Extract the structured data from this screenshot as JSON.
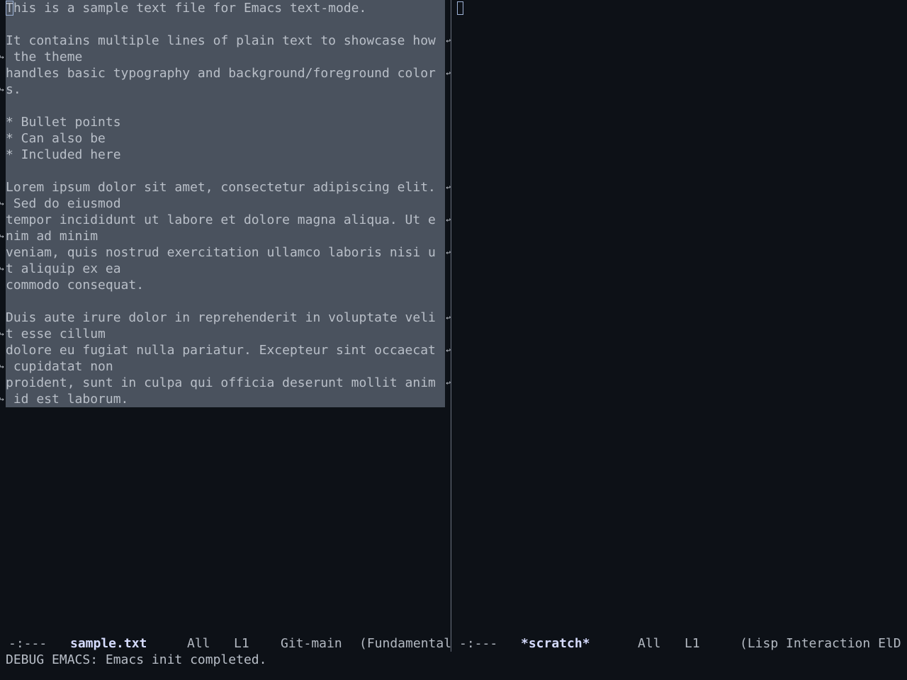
{
  "left_window": {
    "first_char": "T",
    "lines": [
      {
        "text": "his is a sample text file for Emacs text-mode."
      },
      {
        "text": ""
      },
      {
        "text": "It contains multiple lines of plain text to showcase how"
      },
      {
        "text": " the theme"
      },
      {
        "text": "handles basic typography and background/foreground color"
      },
      {
        "text": "s."
      },
      {
        "text": ""
      },
      {
        "text": "* Bullet points"
      },
      {
        "text": "* Can also be"
      },
      {
        "text": "* Included here"
      },
      {
        "text": ""
      },
      {
        "text": "Lorem ipsum dolor sit amet, consectetur adipiscing elit."
      },
      {
        "text": " Sed do eiusmod"
      },
      {
        "text": "tempor incididunt ut labore et dolore magna aliqua. Ut e"
      },
      {
        "text": "nim ad minim"
      },
      {
        "text": "veniam, quis nostrud exercitation ullamco laboris nisi u"
      },
      {
        "text": "t aliquip ex ea"
      },
      {
        "text": "commodo consequat."
      },
      {
        "text": ""
      },
      {
        "text": "Duis aute irure dolor in reprehenderit in voluptate veli"
      },
      {
        "text": "t esse cillum"
      },
      {
        "text": "dolore eu fugiat nulla pariatur. Excepteur sint occaecat"
      },
      {
        "text": " cupidatat non"
      },
      {
        "text": "proident, sunt in culpa qui officia deserunt mollit anim"
      },
      {
        "text": " id est laborum."
      }
    ]
  },
  "modeline_left": {
    "status": "-:---",
    "buffer": "sample.txt",
    "position": "All",
    "line": "L1",
    "vc": "Git-main",
    "mode": "(Fundamental"
  },
  "modeline_right": {
    "status": "-:---",
    "buffer": "*scratch*",
    "position": "All",
    "line": "L1",
    "mode": "(Lisp Interaction ElD"
  },
  "minibuffer": {
    "message": "DEBUG EMACS: Emacs init completed."
  },
  "glyphs": {
    "continuation": "↩",
    "wrap": "↪"
  }
}
